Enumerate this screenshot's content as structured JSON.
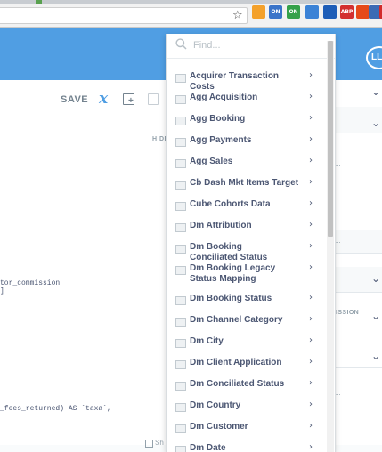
{
  "browser": {
    "extensions": [
      {
        "name": "ext-1",
        "color": "#f4a12b",
        "text": ""
      },
      {
        "name": "ext-2",
        "color": "#3a74c9",
        "text": "ON"
      },
      {
        "name": "ext-3",
        "color": "#35a14a",
        "text": "ON"
      },
      {
        "name": "ext-4",
        "color": "#3b82d6",
        "text": ""
      },
      {
        "name": "ext-5",
        "color": "#1e5eb8",
        "text": ""
      },
      {
        "name": "ext-6",
        "color": "#d32f2f",
        "text": "ABP"
      },
      {
        "name": "ext-7",
        "color": "#e64a19",
        "text": ""
      },
      {
        "name": "ext-8",
        "color": "#3a6bb5",
        "text": ""
      },
      {
        "name": "ext-9",
        "color": "#d12b2b",
        "text": ""
      }
    ]
  },
  "header": {
    "avatar_initials": "LL"
  },
  "toolbar": {
    "save_label": "SAVE",
    "hide_label": "HIDE"
  },
  "editor": {
    "code_lines": [
      "tor_commission",
      "]",
      "_fees_returned) AS `taxa`,"
    ],
    "bottom_label": "Sh"
  },
  "right_panel": {
    "dots": "...",
    "label": "ISSION"
  },
  "dropdown": {
    "search_placeholder": "Find...",
    "items": [
      {
        "label": "Acquirer Transaction Costs"
      },
      {
        "label": "Agg Acquisition"
      },
      {
        "label": "Agg Booking"
      },
      {
        "label": "Agg Payments"
      },
      {
        "label": "Agg Sales"
      },
      {
        "label": "Cb Dash Mkt Items Target"
      },
      {
        "label": "Cube Cohorts Data"
      },
      {
        "label": "Dm Attribution"
      },
      {
        "label": "Dm Booking Conciliated Status"
      },
      {
        "label": "Dm Booking Legacy Status Mapping"
      },
      {
        "label": "Dm Booking Status"
      },
      {
        "label": "Dm Channel Category"
      },
      {
        "label": "Dm City"
      },
      {
        "label": "Dm Client Application"
      },
      {
        "label": "Dm Conciliated Status"
      },
      {
        "label": "Dm Country"
      },
      {
        "label": "Dm Customer"
      },
      {
        "label": "Dm Date"
      }
    ]
  },
  "colors": {
    "brand": "#509ee3",
    "text": "#4c5773",
    "muted": "#74838f"
  }
}
